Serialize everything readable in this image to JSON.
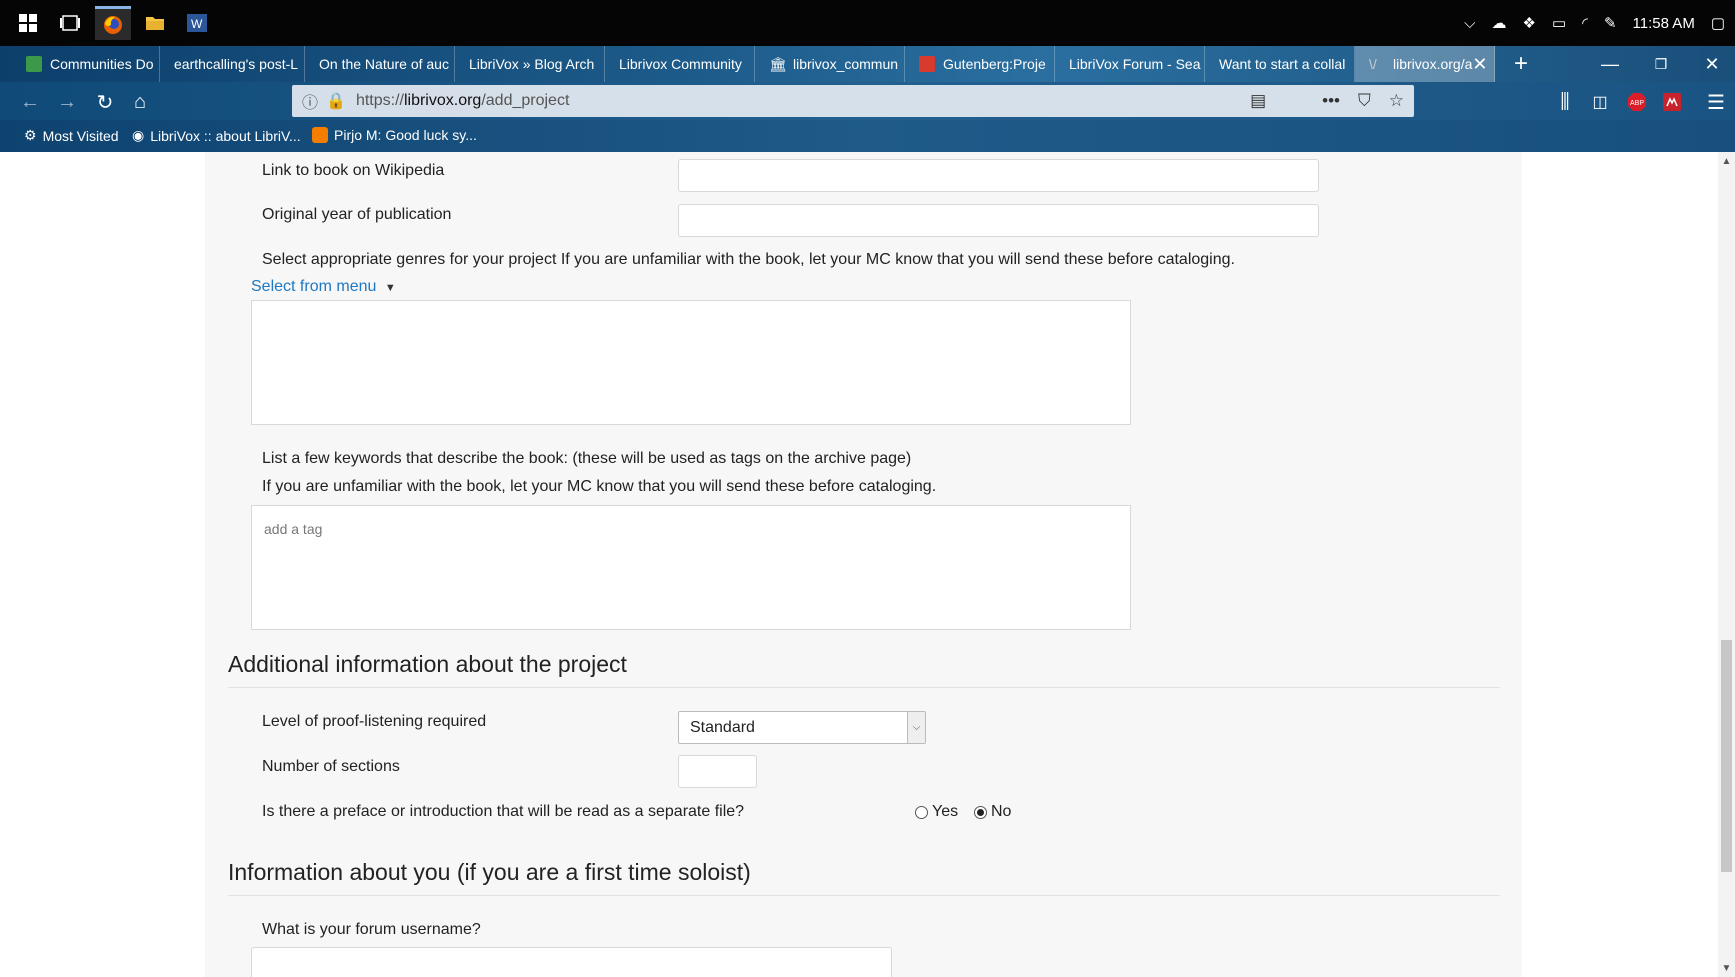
{
  "taskbar": {
    "time": "11:58 AM"
  },
  "tabs": [
    {
      "label": "Communities Do",
      "color": "#3a9a4a"
    },
    {
      "label": "earthcalling's post-L",
      "color": ""
    },
    {
      "label": "On the Nature of auc",
      "color": ""
    },
    {
      "label": "LibriVox » Blog Arch",
      "color": ""
    },
    {
      "label": "Librivox Community",
      "color": ""
    },
    {
      "label": "librivox_commun",
      "color": "#ffffff"
    },
    {
      "label": "Gutenberg:Proje",
      "color": "#d83a2e"
    },
    {
      "label": "LibriVox Forum - Sea",
      "color": ""
    },
    {
      "label": "Want to start a collal",
      "color": ""
    },
    {
      "label": "librivox.org/a",
      "color": "#888888"
    }
  ],
  "navbar": {
    "url_scheme": "https://",
    "url_host": "librivox.org",
    "url_path": "/add_project"
  },
  "bookmarks": [
    {
      "label": "Most Visited"
    },
    {
      "label": "LibriVox :: about LibriV..."
    },
    {
      "label": "Pirjo M: Good luck sy..."
    }
  ],
  "form": {
    "wikipedia_label": "Link to book on Wikipedia",
    "wikipedia_value": "",
    "year_label": "Original year of publication",
    "year_value": "",
    "genres_label": "Select appropriate genres for your project If you are unfamiliar with the book, let your MC know that you will send these before cataloging.",
    "genres_menu_link": "Select from menu",
    "genres_value": "",
    "keywords_label_1": "List a few keywords that describe the book: (these will be used as tags on the archive page)",
    "keywords_label_2": "If you are unfamiliar with the book, let your MC know that you will send these before cataloging.",
    "tags_placeholder": "add a tag"
  },
  "additional": {
    "title": "Additional information about the project",
    "proof_label": "Level of proof-listening required",
    "proof_value": "Standard",
    "sections_label": "Number of sections",
    "sections_value": "",
    "preface_question": "Is there a preface or introduction that will be read as a separate file?",
    "yes_label": "Yes",
    "no_label": "No",
    "preface_selected": "No"
  },
  "about_you": {
    "title": "Information about you (if you are a first time soloist)",
    "forum_label": "What is your forum username?",
    "forum_value": ""
  },
  "colors": {
    "link": "#1e78c2",
    "abp_badge": "#d91e2a"
  }
}
